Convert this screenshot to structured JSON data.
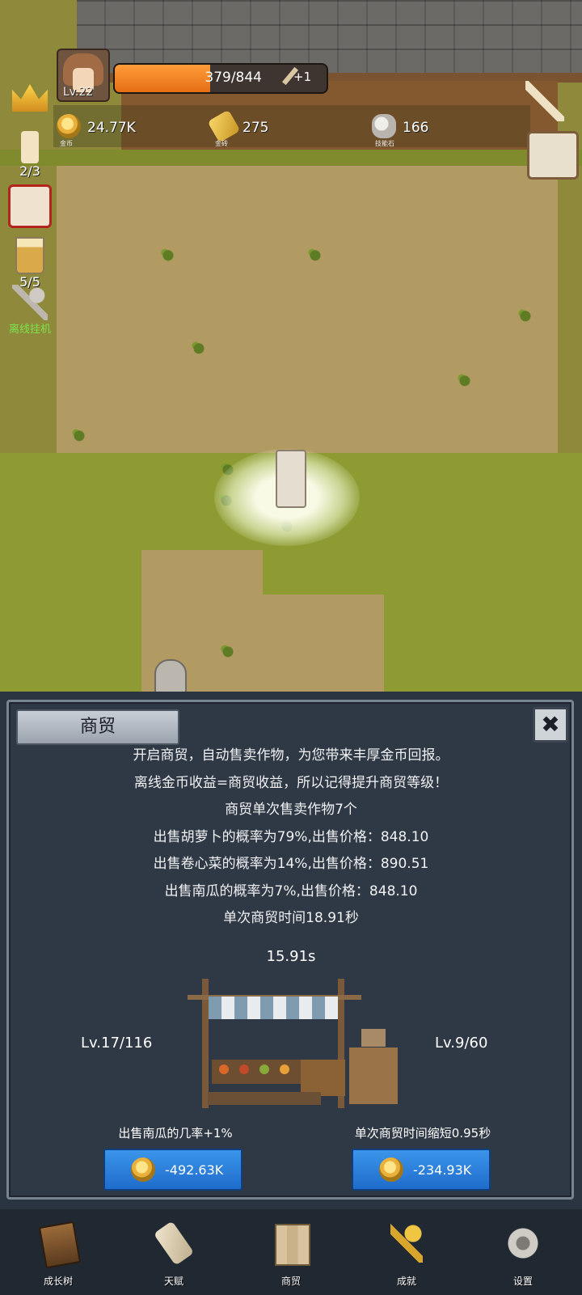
{
  "hud": {
    "level": "Lv.22",
    "xp_text": "379/844",
    "xp_progress": 0.449,
    "xp_bonus": "+1",
    "resources": [
      {
        "icon": "coin-icon",
        "value": "24.77K",
        "label": "金币"
      },
      {
        "icon": "gold-bar-icon",
        "value": "275",
        "label": "金砖"
      },
      {
        "icon": "skill-stone-icon",
        "value": "166",
        "label": "技能石"
      }
    ],
    "side": {
      "candle_count": "2/3",
      "cup_count": "5/5",
      "idle_label": "离线挂机"
    }
  },
  "panel": {
    "title": "商贸",
    "close_symbol": "✖",
    "lines": [
      "开启商贸，自动售卖作物，为您带来丰厚金币回报。",
      "离线金币收益=商贸收益，所以记得提升商贸等级！",
      "商贸单次售卖作物7个",
      "出售胡萝卜的概率为79%,出售价格：848.10",
      "出售卷心菜的概率为14%,出售价格：890.51",
      "出售南瓜的概率为7%,出售价格：848.10",
      "单次商贸时间18.91秒"
    ],
    "timer": "15.91s",
    "left_level": "Lv.17/116",
    "right_level": "Lv.9/60",
    "upgrades": [
      {
        "label": "出售南瓜的几率+1%",
        "cost": "-492.63K"
      },
      {
        "label": "单次商贸时间缩短0.95秒",
        "cost": "-234.93K"
      }
    ]
  },
  "nav": [
    {
      "label": "成长树",
      "icon": "book-icon"
    },
    {
      "label": "天赋",
      "icon": "scroll-icon"
    },
    {
      "label": "商贸",
      "icon": "map-icon"
    },
    {
      "label": "成就",
      "icon": "gold-key-icon"
    },
    {
      "label": "设置",
      "icon": "gear-icon"
    }
  ],
  "colors": {
    "panel_bg": "#2f3845",
    "button_blue": "#2a82de",
    "xp_orange": "#f08a26"
  }
}
